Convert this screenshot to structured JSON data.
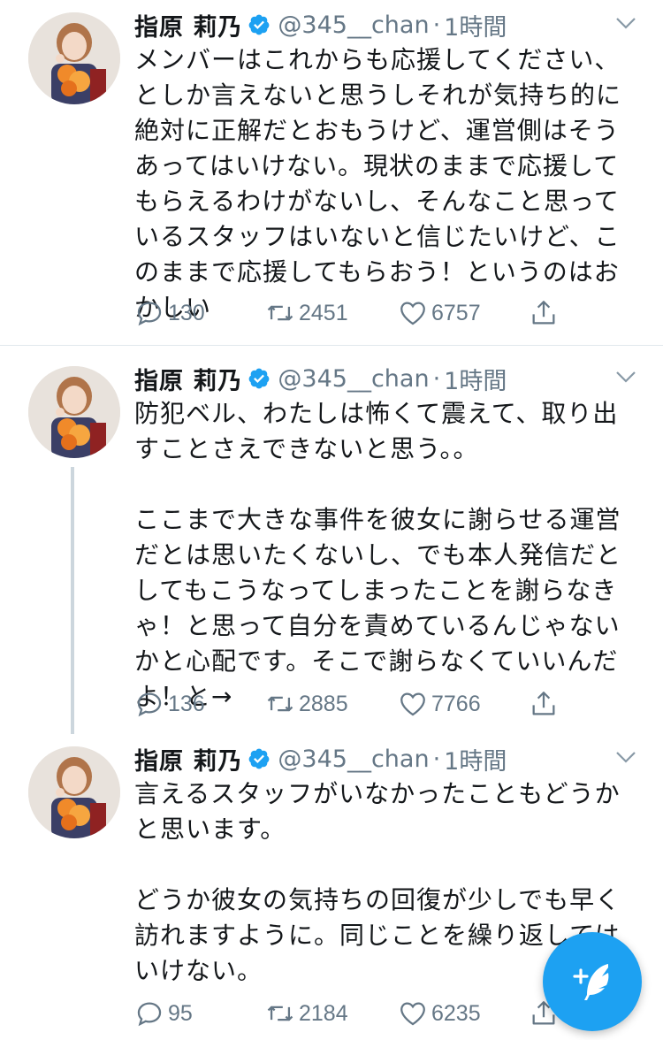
{
  "tweets": [
    {
      "author": "指原 莉乃",
      "handle": "@345__chan",
      "separator": "·",
      "time": "1時間",
      "text": "メンバーはこれからも応援してください、としか言えないと思うしそれが気持ち的に絶対に正解だとおもうけど、運営側はそうあってはいけない。現状のままで応援してもらえるわけがないし、そんなこと思っているスタッフはいないと信じたいけど、このままで応援してもらおう！というのはおかしい",
      "reply_count": "130",
      "retweet_count": "2451",
      "like_count": "6757"
    },
    {
      "author": "指原 莉乃",
      "handle": "@345__chan",
      "separator": "·",
      "time": "1時間",
      "text": "防犯ベル、わたしは怖くて震えて、取り出すことさえできないと思う。。\n\nここまで大きな事件を彼女に謝らせる運営だとは思いたくないし、でも本人発信だとしてもこうなってしまったことを謝らなきゃ！と思って自分を責めているんじゃないかと心配です。そこで謝らなくていいんだよ！と→",
      "reply_count": "136",
      "retweet_count": "2885",
      "like_count": "7766"
    },
    {
      "author": "指原 莉乃",
      "handle": "@345__chan",
      "separator": "·",
      "time": "1時間",
      "text": "言えるスタッフがいなかったこともどうかと思います。\n\nどうか彼女の気持ちの回復が少しでも早く訪れますように。同じことを繰り返してはいけない。",
      "reply_count": "95",
      "retweet_count": "2184",
      "like_count": "6235"
    }
  ],
  "icons": {
    "verified": "verified-badge-icon",
    "chevron": "chevron-down-icon",
    "reply": "reply-icon",
    "retweet": "retweet-icon",
    "like": "heart-icon",
    "share": "share-icon",
    "compose": "compose-tweet-icon"
  },
  "colors": {
    "accent": "#1da1f2",
    "secondary_text": "#657786",
    "divider": "#e1e8ed"
  }
}
